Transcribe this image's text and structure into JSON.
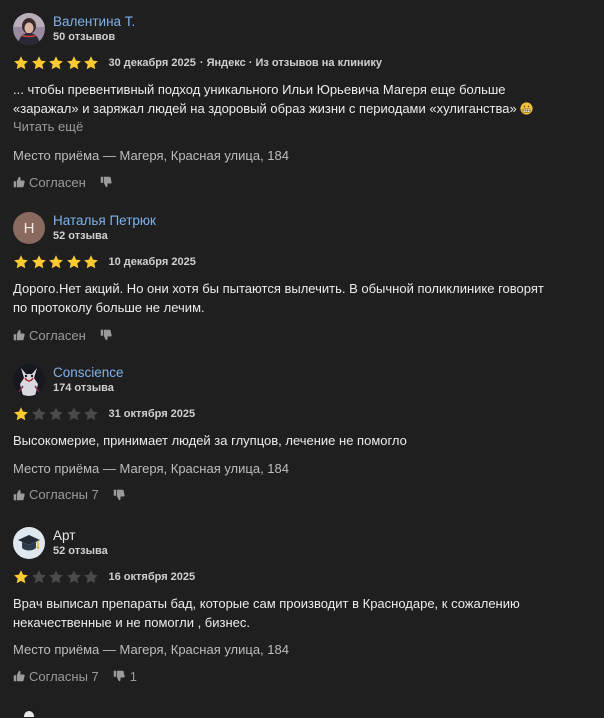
{
  "reviews": [
    {
      "author": "Валентина Т.",
      "count": "50 отзывов",
      "rating": 5,
      "date": "30 декабря 2025",
      "source": "· Яндекс · Из отзывов на клинику",
      "text_line1": "... чтобы превентивный подход уникального Ильи Юрьевича Магеря еще больше",
      "text_line2": "«заражал» и заряжал людей на здоровый образ жизни с периодами «хулиганства»",
      "read_more": "Читать ещё",
      "place": "Место приёма — Магеря, Красная улица, 184",
      "like_label": "Согласен",
      "dislike_count": ""
    },
    {
      "author": "Наталья Петрюк",
      "avatar_letter": "Н",
      "count": "52 отзыва",
      "rating": 5,
      "date": "10 декабря 2025",
      "text_line1": "Дорого.Нет акций. Но они хотя бы пытаются вылечить. В обычной поликлинике говорят",
      "text_line2": "по протоколу больше не лечим.",
      "like_label": "Согласен",
      "dislike_count": ""
    },
    {
      "author": "Conscience",
      "count": "174 отзыва",
      "rating": 1,
      "date": "31 октября 2025",
      "text_line1": "Высокомерие, принимает людей за глупцов, лечение не помогло",
      "place": "Место приёма — Магеря, Красная улица, 184",
      "like_label": "Согласны 7",
      "dislike_count": ""
    },
    {
      "author": "Арт",
      "count": "52 отзыва",
      "rating": 1,
      "date": "16 октября 2025",
      "text_line1": "Врач выписал препараты бад, которые сам производит в Краснодаре, к сожалению",
      "text_line2": "некачественные и не помогли , бизнес.",
      "place": "Место приёма — Магеря, Красная улица, 184",
      "like_label": "Согласны 7",
      "dislike_count": "1"
    }
  ],
  "colors": {
    "background": "#1f1f20",
    "author_link": "#7fb2ea",
    "star_filled": "#fccb31",
    "star_empty": "#4a4a4a"
  }
}
